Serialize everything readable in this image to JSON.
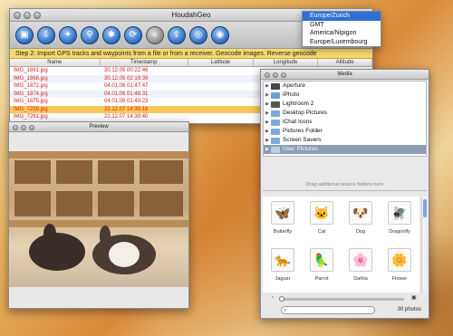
{
  "main_window": {
    "title": "HoudahGeo",
    "step_text": "Step 2: Import GPS tracks and waypoints from a file or from a receiver. Geocode images. Reverse geocode",
    "columns": [
      "Name",
      "Timestamp",
      "Latitude",
      "Longitude",
      "Altitude"
    ],
    "rows": [
      {
        "name": "IMG_1861.jpg",
        "timestamp": "30.12.05 00:22:46",
        "selected": false
      },
      {
        "name": "IMG_1868.jpg",
        "timestamp": "30.12.05 02:19:39",
        "selected": false
      },
      {
        "name": "IMG_1872.jpg",
        "timestamp": "04.01.06 01:47:47",
        "selected": false
      },
      {
        "name": "IMG_1874.jpg",
        "timestamp": "04.01.06 01:48:31",
        "selected": false
      },
      {
        "name": "IMG_1875.jpg",
        "timestamp": "04.01.06 01:49:23",
        "selected": false
      },
      {
        "name": "IMG_7259.jpg",
        "timestamp": "22.12.07 14:30:16",
        "selected": true
      },
      {
        "name": "IMG_7261.jpg",
        "timestamp": "22.12.07 14:30:40",
        "selected": false
      }
    ]
  },
  "timezone_menu": {
    "items": [
      "Europe/Zurich",
      "GMT",
      "America/Nipigon",
      "Europe/Luxembourg"
    ],
    "selected": "Europe/Zurich"
  },
  "preview_window": {
    "title": "Preview"
  },
  "media_window": {
    "title": "Media",
    "sources": [
      {
        "label": "Aperture",
        "icon": "aperture-icon",
        "color": "#444444"
      },
      {
        "label": "iPhoto",
        "icon": "iphoto-icon",
        "color": "#6aa0d8"
      },
      {
        "label": "Lightroom 2",
        "icon": "lightroom-icon",
        "color": "#555555"
      },
      {
        "label": "Desktop Pictures",
        "icon": "folder-icon",
        "color": "#7fa9d6"
      },
      {
        "label": "iChat Icons",
        "icon": "folder-icon",
        "color": "#7fa9d6"
      },
      {
        "label": "Pictures Folder",
        "icon": "folder-icon",
        "color": "#7fa9d6"
      },
      {
        "label": "Screen Savers",
        "icon": "folder-icon",
        "color": "#7fa9d6"
      },
      {
        "label": "User Pictures",
        "icon": "folder-icon",
        "color": "#7fa9d6"
      }
    ],
    "selected_source": "User Pictures",
    "drop_hint": "Drag additional source folders here",
    "thumbnails": [
      {
        "label": "Butterfly",
        "glyph": "🦋"
      },
      {
        "label": "Cat",
        "glyph": "🐱"
      },
      {
        "label": "Dog",
        "glyph": "🐶"
      },
      {
        "label": "Dragonfly",
        "glyph": "🪰"
      },
      {
        "label": "Jaguar",
        "glyph": "🐆"
      },
      {
        "label": "Parrot",
        "glyph": "🦜"
      },
      {
        "label": "Dahlia",
        "glyph": "🌸"
      },
      {
        "label": "Flower",
        "glyph": "🌼"
      }
    ],
    "photo_count": "30 photos",
    "search_value": ""
  },
  "colors": {
    "step_bar": "#f8da6d",
    "selected_row": "#f9c85a",
    "filename_red": "#dd2222",
    "menu_highlight": "#2f6fd6",
    "source_highlight": "#8b9bb8"
  }
}
